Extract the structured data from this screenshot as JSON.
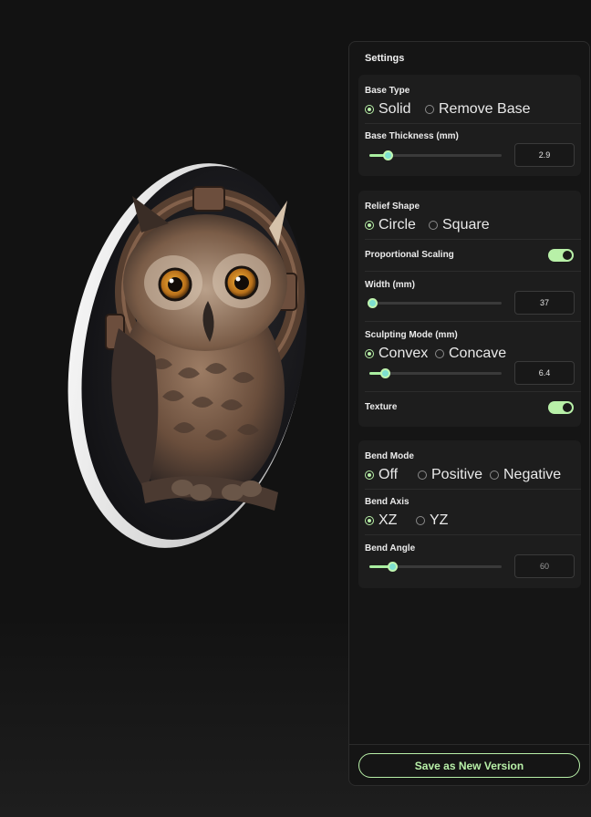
{
  "settings": {
    "title": "Settings",
    "base_type": {
      "label": "Base Type",
      "options": [
        "Solid",
        "Remove Base"
      ],
      "selected": "Solid"
    },
    "base_thickness": {
      "label": "Base Thickness (mm)",
      "value": "2.9",
      "level": 0.14
    },
    "relief_shape": {
      "label": "Relief Shape",
      "options": [
        "Circle",
        "Square"
      ],
      "selected": "Circle"
    },
    "proportional_scaling": {
      "label": "Proportional Scaling",
      "on": true
    },
    "width": {
      "label": "Width (mm)",
      "value": "37",
      "level": 0.02
    },
    "sculpting_mode": {
      "label": "Sculpting Mode (mm)",
      "options": [
        "Convex",
        "Concave"
      ],
      "selected": "Convex",
      "value": "6.4",
      "level": 0.12
    },
    "texture": {
      "label": "Texture",
      "on": true
    },
    "bend_mode": {
      "label": "Bend Mode",
      "options": [
        "Off",
        "Positive",
        "Negative"
      ],
      "selected": "Off"
    },
    "bend_axis": {
      "label": "Bend Axis",
      "options": [
        "XZ",
        "YZ"
      ],
      "selected": "XZ"
    },
    "bend_angle": {
      "label": "Bend Angle",
      "value": "60",
      "level": 0.17
    },
    "save_button": "Save as New Version"
  },
  "colors": {
    "accent": "#b8f0a8",
    "thumb": "#7ee0d0",
    "panel": "#151515",
    "card": "#1d1d1d"
  },
  "preview": {
    "subject": "owl relief on round disc base"
  }
}
